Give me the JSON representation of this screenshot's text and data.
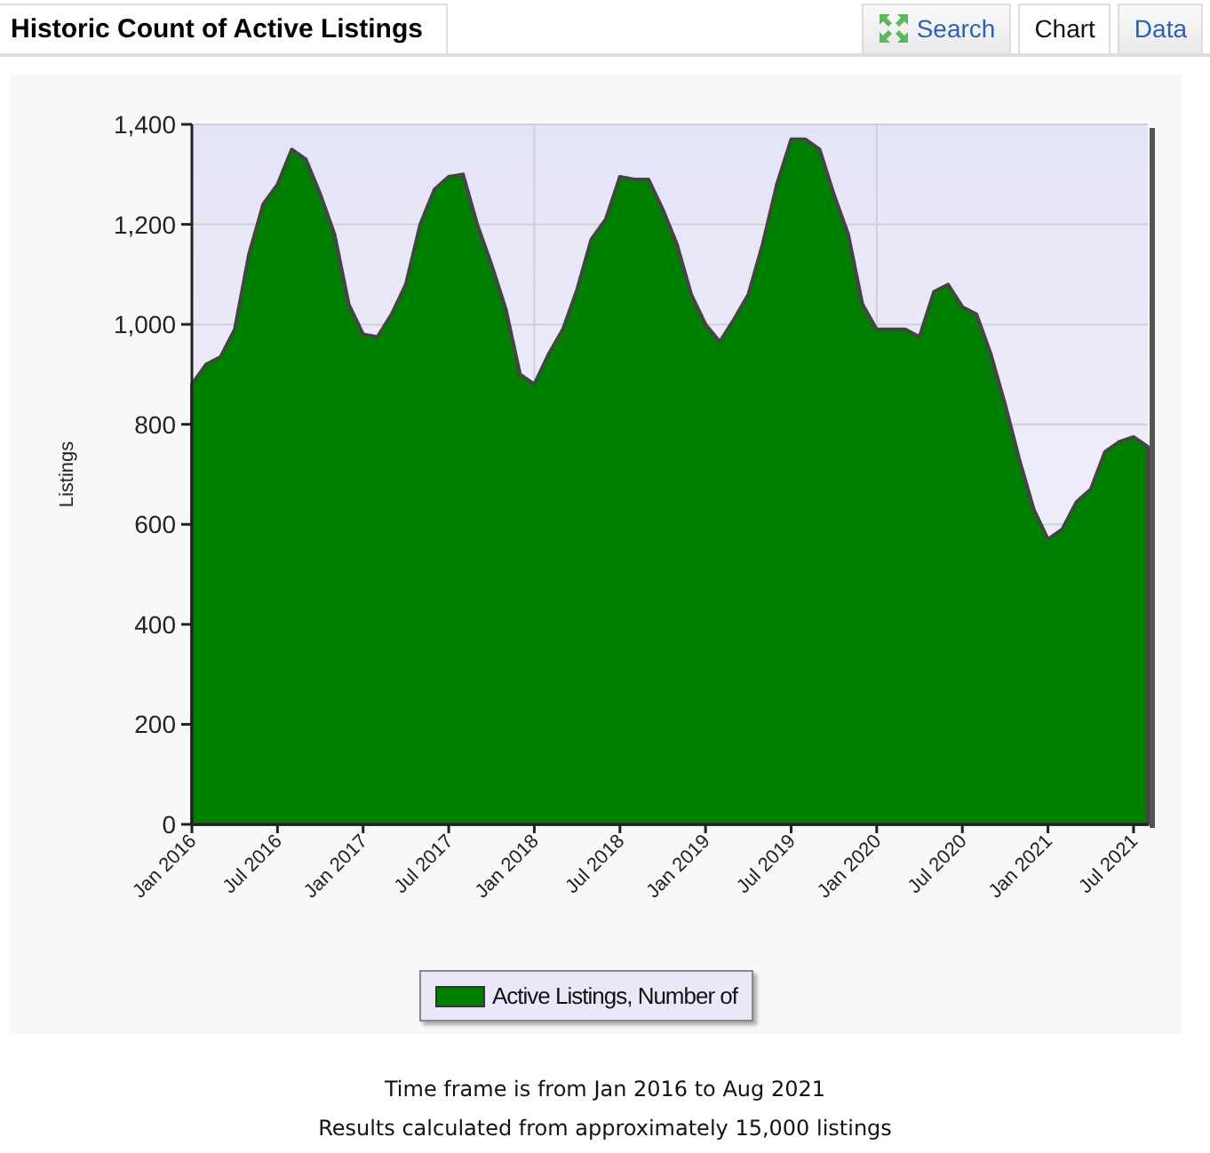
{
  "panel_title": "Historic Count of Active Listings",
  "tabs": [
    {
      "label": "Search",
      "selected": false,
      "icon": true
    },
    {
      "label": "Chart",
      "selected": true,
      "icon": false
    },
    {
      "label": "Data",
      "selected": false,
      "icon": false
    }
  ],
  "chart": {
    "chart_data": {
      "type": "area",
      "ylabel": "Listings",
      "grid": true,
      "categories": [
        "Jan 2016",
        null,
        null,
        null,
        null,
        null,
        "Jul 2016",
        null,
        null,
        null,
        null,
        null,
        "Jan 2017",
        null,
        null,
        null,
        null,
        null,
        "Jul 2017",
        null,
        null,
        null,
        null,
        null,
        "Jan 2018",
        null,
        null,
        null,
        null,
        null,
        "Jul 2018",
        null,
        null,
        null,
        null,
        null,
        "Jan 2019",
        null,
        null,
        null,
        null,
        null,
        "Jul 2019",
        null,
        null,
        null,
        null,
        null,
        "Jan 2020",
        null,
        null,
        null,
        null,
        null,
        "Jul 2020",
        null,
        null,
        null,
        null,
        null,
        "Jan 2021",
        null,
        null,
        null,
        null,
        null,
        "Jul 2021",
        null
      ],
      "series": [
        {
          "name": "Active Listings, Number of",
          "color": "#008000",
          "values": [
            880,
            920,
            935,
            990,
            1140,
            1240,
            1280,
            1350,
            1330,
            1260,
            1180,
            1040,
            980,
            975,
            1020,
            1080,
            1200,
            1270,
            1295,
            1300,
            1200,
            1120,
            1030,
            900,
            880,
            940,
            990,
            1070,
            1170,
            1210,
            1295,
            1290,
            1290,
            1230,
            1160,
            1060,
            1000,
            965,
            1010,
            1060,
            1160,
            1280,
            1370,
            1370,
            1350,
            1260,
            1180,
            1040,
            990,
            990,
            990,
            975,
            1065,
            1080,
            1035,
            1020,
            940,
            840,
            730,
            630,
            570,
            590,
            645,
            670,
            745,
            765,
            775,
            755
          ]
        }
      ],
      "ylim": [
        0,
        1400
      ],
      "yticks": [
        {
          "value": 0,
          "label": "0"
        },
        {
          "value": 200,
          "label": "200"
        },
        {
          "value": 400,
          "label": "400"
        },
        {
          "value": 600,
          "label": "600"
        },
        {
          "value": 800,
          "label": "800"
        },
        {
          "value": 1000,
          "label": "1,000"
        },
        {
          "value": 1200,
          "label": "1,200"
        },
        {
          "value": 1400,
          "label": "1,400"
        }
      ]
    }
  },
  "footer": [
    "Time frame is from Jan 2016 to Aug 2021",
    "Results calculated from approximately 15,000 listings"
  ]
}
